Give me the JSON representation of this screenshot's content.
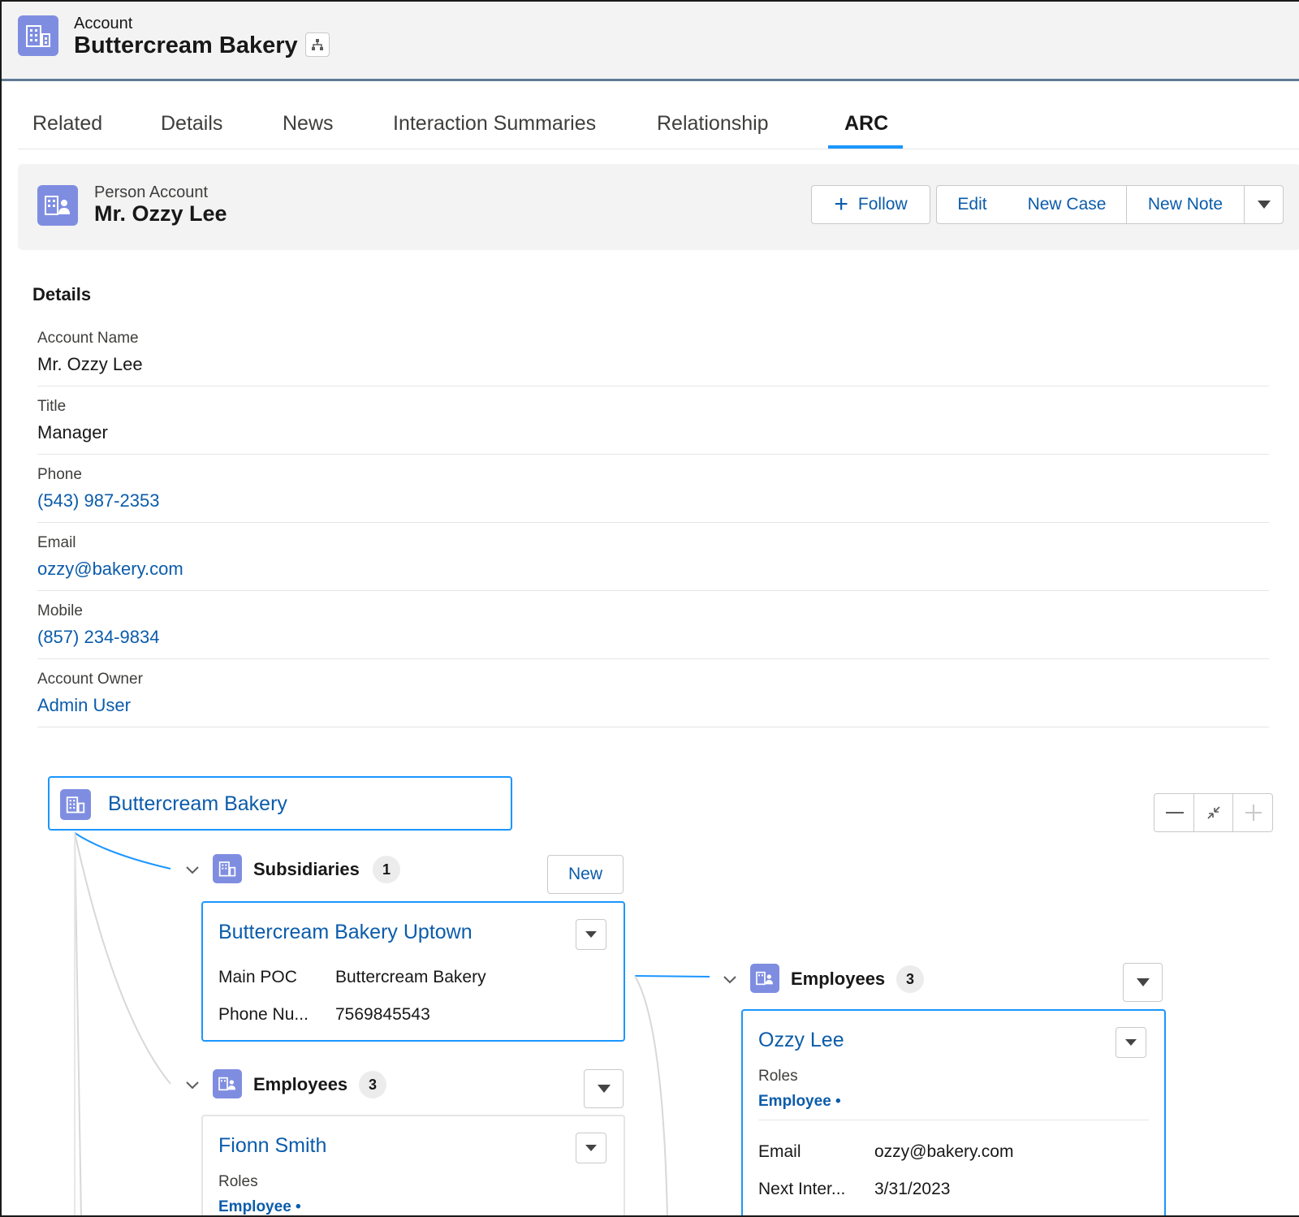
{
  "header": {
    "object_label": "Account",
    "record_title": "Buttercream Bakery",
    "icon": "account-building-icon",
    "hierarchy_icon": "hierarchy-icon"
  },
  "tabs": [
    {
      "label": "Related",
      "active": false
    },
    {
      "label": "Details",
      "active": false
    },
    {
      "label": "News",
      "active": false
    },
    {
      "label": "Interaction Summaries",
      "active": false
    },
    {
      "label": "Relationship",
      "active": false
    },
    {
      "label": "ARC",
      "active": true
    }
  ],
  "person_account": {
    "object_label": "Person Account",
    "record_title": "Mr. Ozzy Lee",
    "icon": "person-account-icon",
    "actions": {
      "follow": "Follow",
      "edit": "Edit",
      "new_case": "New Case",
      "new_note": "New Note"
    }
  },
  "details": {
    "heading": "Details",
    "fields": [
      {
        "label": "Account Name",
        "value": "Mr. Ozzy Lee",
        "link": false
      },
      {
        "label": "Title",
        "value": "Manager",
        "link": false
      },
      {
        "label": "Phone",
        "value": "(543) 987-2353",
        "link": true
      },
      {
        "label": "Email",
        "value": "ozzy@bakery.com",
        "link": true
      },
      {
        "label": "Mobile",
        "value": "(857) 234-9834",
        "link": true
      },
      {
        "label": "Account Owner",
        "value": "Admin User",
        "link": true
      }
    ]
  },
  "arc": {
    "root": {
      "name": "Buttercream Bakery"
    },
    "zoom_controls": {
      "zoom_out": "—",
      "fit": "fit-icon",
      "zoom_in": "+"
    },
    "subsidiaries": {
      "label": "Subsidiaries",
      "count": "1",
      "new_label": "New",
      "card": {
        "name": "Buttercream Bakery Uptown",
        "rows": [
          {
            "key": "Main POC",
            "value": "Buttercream Bakery"
          },
          {
            "key": "Phone Nu...",
            "value": "7569845543"
          }
        ]
      }
    },
    "employees_left": {
      "label": "Employees",
      "count": "3",
      "card": {
        "name": "Fionn Smith",
        "roles_label": "Roles",
        "role": "Employee •"
      }
    },
    "employees_right": {
      "label": "Employees",
      "count": "3",
      "card": {
        "name": "Ozzy Lee",
        "roles_label": "Roles",
        "role": "Employee •",
        "rows": [
          {
            "key": "Email",
            "value": "ozzy@bakery.com"
          },
          {
            "key": "Next Inter...",
            "value": "3/31/2023"
          }
        ]
      }
    }
  },
  "colors": {
    "accent": "#1b96ff",
    "link": "#0b5cab",
    "object_icon": "#7f8de1",
    "header_bg": "#f3f3f3"
  }
}
